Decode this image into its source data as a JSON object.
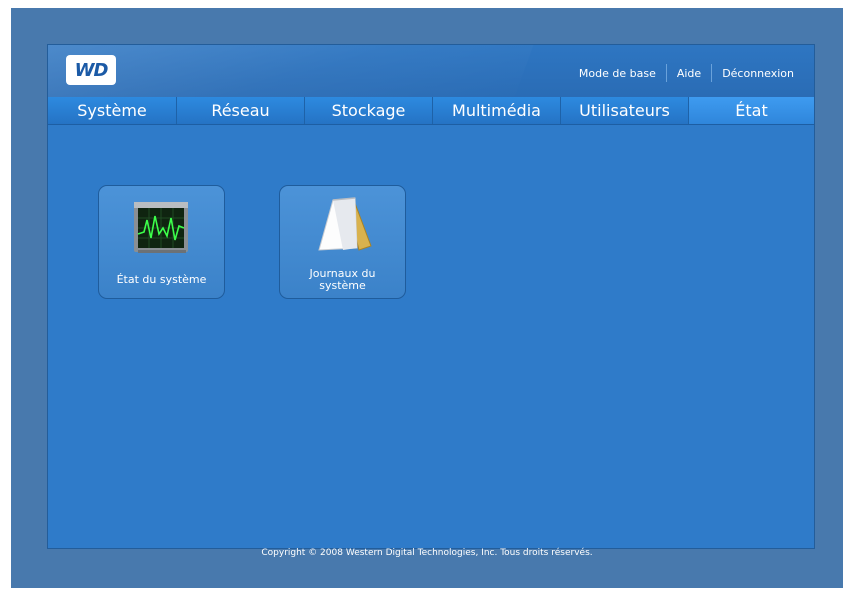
{
  "header": {
    "logo_text": "WD",
    "links": [
      "Mode de base",
      "Aide",
      "Déconnexion"
    ]
  },
  "tabs": [
    {
      "label": "Système"
    },
    {
      "label": "Réseau"
    },
    {
      "label": "Stockage"
    },
    {
      "label": "Multimédia"
    },
    {
      "label": "Utilisateurs"
    },
    {
      "label": "État",
      "active": true
    }
  ],
  "main": {
    "items": [
      {
        "label": "État du système",
        "icon": "system-monitor-icon"
      },
      {
        "label_line1": "Journaux du",
        "label_line2": "système",
        "icon": "notepad-icon"
      }
    ]
  },
  "footer": {
    "copyright": "Copyright © 2008 Western Digital Technologies, Inc. Tous droits réservés."
  },
  "colors": {
    "panel": "#2f7bc9",
    "frame": "#4879ad",
    "card": "#3b82c9"
  }
}
